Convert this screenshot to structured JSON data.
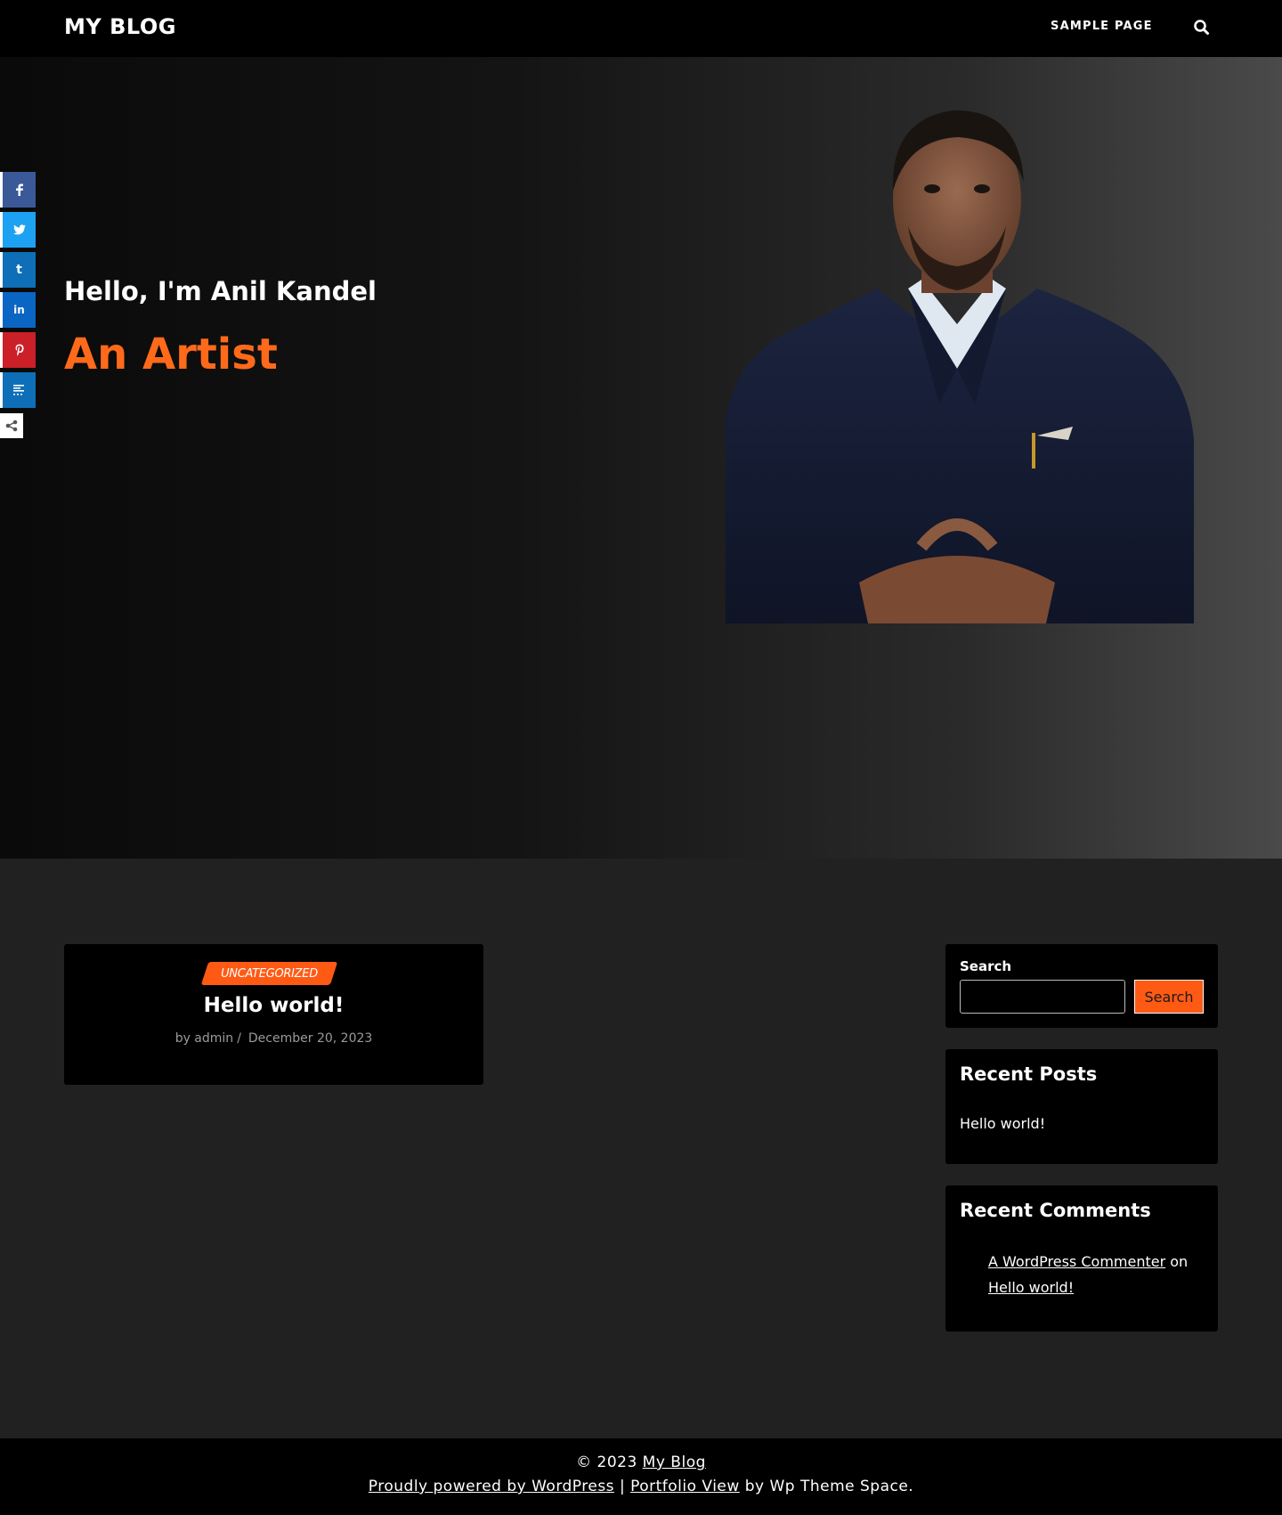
{
  "header": {
    "site_title": "MY BLOG",
    "nav": [
      "SAMPLE PAGE"
    ],
    "search_icon": "search-icon"
  },
  "hero": {
    "greeting": "Hello, I'm Anil Kandel",
    "role": "An Artist",
    "accent_color": "#ff6a1a"
  },
  "social": [
    {
      "name": "facebook-icon",
      "color": "#3b5998"
    },
    {
      "name": "twitter-icon",
      "color": "#1da1f2"
    },
    {
      "name": "tumblr-icon",
      "color": "#0e6fb8"
    },
    {
      "name": "linkedin-icon",
      "color": "#0a66c2"
    },
    {
      "name": "pinterest-icon",
      "color": "#cb2027"
    },
    {
      "name": "more-icon",
      "color": "#0e6fb8"
    }
  ],
  "post": {
    "category": "UNCATEGORIZED",
    "title": "Hello world!",
    "author": "by admin",
    "separator": "/",
    "date": "December 20, 2023"
  },
  "sidebar": {
    "search": {
      "label": "Search",
      "placeholder": "",
      "button": "Search"
    },
    "recent_posts": {
      "title": "Recent Posts",
      "items": [
        "Hello world!"
      ]
    },
    "recent_comments": {
      "title": "Recent Comments",
      "author": "A WordPress Commenter",
      "on": "on",
      "post": "Hello world!"
    }
  },
  "footer": {
    "copyright": "© 2023",
    "site_link": "My Blog",
    "powered": "Proudly powered by WordPress",
    "divider": "|",
    "theme_link": "Portfolio View",
    "by": "by Wp Theme Space."
  }
}
